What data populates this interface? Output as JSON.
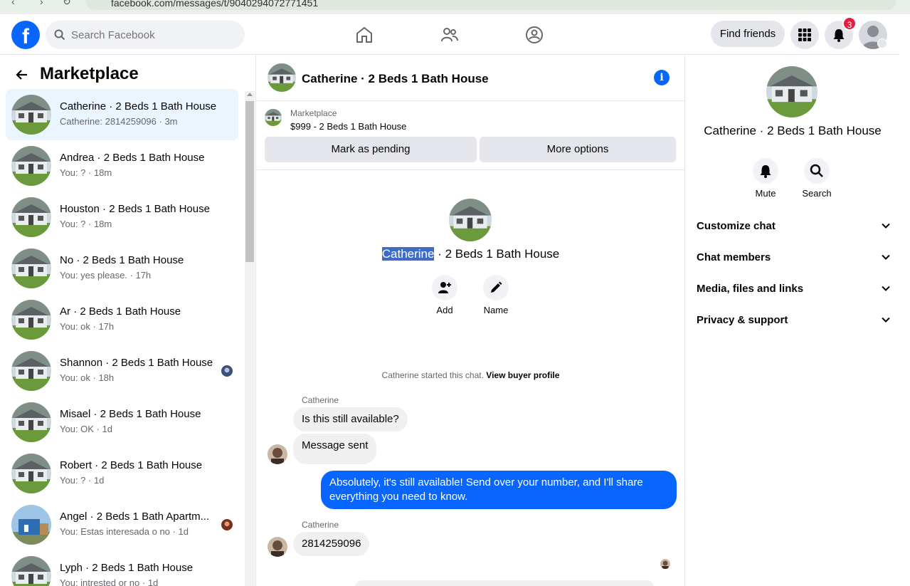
{
  "browser": {
    "url": "facebook.com/messages/t/9040294072771451"
  },
  "topnav": {
    "logo": "f",
    "search_placeholder": "Search Facebook",
    "find_friends": "Find friends",
    "notifications_count": "3"
  },
  "sidebar": {
    "title": "Marketplace",
    "conversations": [
      {
        "name": "Catherine · 2 Beds 1 Bath House",
        "snippet": "Catherine: 2814259096 · 3m"
      },
      {
        "name": "Andrea · 2 Beds 1 Bath House",
        "snippet": "You: ? · 18m"
      },
      {
        "name": "Houston · 2 Beds 1 Bath House",
        "snippet": "You: ? · 18m"
      },
      {
        "name": "No · 2 Beds 1 Bath House",
        "snippet": "You: yes please. · 17h"
      },
      {
        "name": "Ar · 2 Beds 1 Bath House",
        "snippet": "You: ok · 17h"
      },
      {
        "name": "Shannon · 2 Beds 1 Bath House",
        "snippet": "You: ok · 18h"
      },
      {
        "name": "Misael · 2 Beds 1 Bath House",
        "snippet": "You: OK · 1d"
      },
      {
        "name": "Robert · 2 Beds 1 Bath House",
        "snippet": "You: ? · 1d"
      },
      {
        "name": "Angel · 2 Beds 1 Bath Apartm...",
        "snippet": "You: Estas interesada o no · 1d"
      },
      {
        "name": "Lyph · 2 Beds 1 Bath House",
        "snippet": "You: intrested or no · 1d"
      }
    ]
  },
  "chat": {
    "title": "Catherine · 2 Beds 1 Bath House",
    "listing_source": "Marketplace",
    "listing_price": "$999 - 2 Beds 1 Bath House",
    "mark_pending": "Mark as pending",
    "more_options": "More options",
    "hero_name_highlight": "Catherine",
    "hero_name_rest": " · 2 Beds 1 Bath House",
    "action_add": "Add",
    "action_name": "Name",
    "started_text": "Catherine started this chat.",
    "view_profile": "View buyer profile",
    "messages": [
      {
        "sender": "Catherine",
        "text": "Is this still available?"
      },
      {
        "text": "Message sent"
      },
      {
        "text": "Absolutely, it's still available! Send over your number, and I'll share everything you need to know."
      },
      {
        "sender": "Catherine",
        "text": "2814259096"
      }
    ]
  },
  "details": {
    "name": "Catherine · 2 Beds 1 Bath House",
    "mute": "Mute",
    "search": "Search",
    "sections": [
      "Customize chat",
      "Chat members",
      "Media, files and links",
      "Privacy & support"
    ]
  },
  "colors": {
    "accent": "#0866ff",
    "active_row": "#ebf5ff",
    "bubble_gray": "#f0f0f0",
    "badge": "#e41e3f"
  }
}
